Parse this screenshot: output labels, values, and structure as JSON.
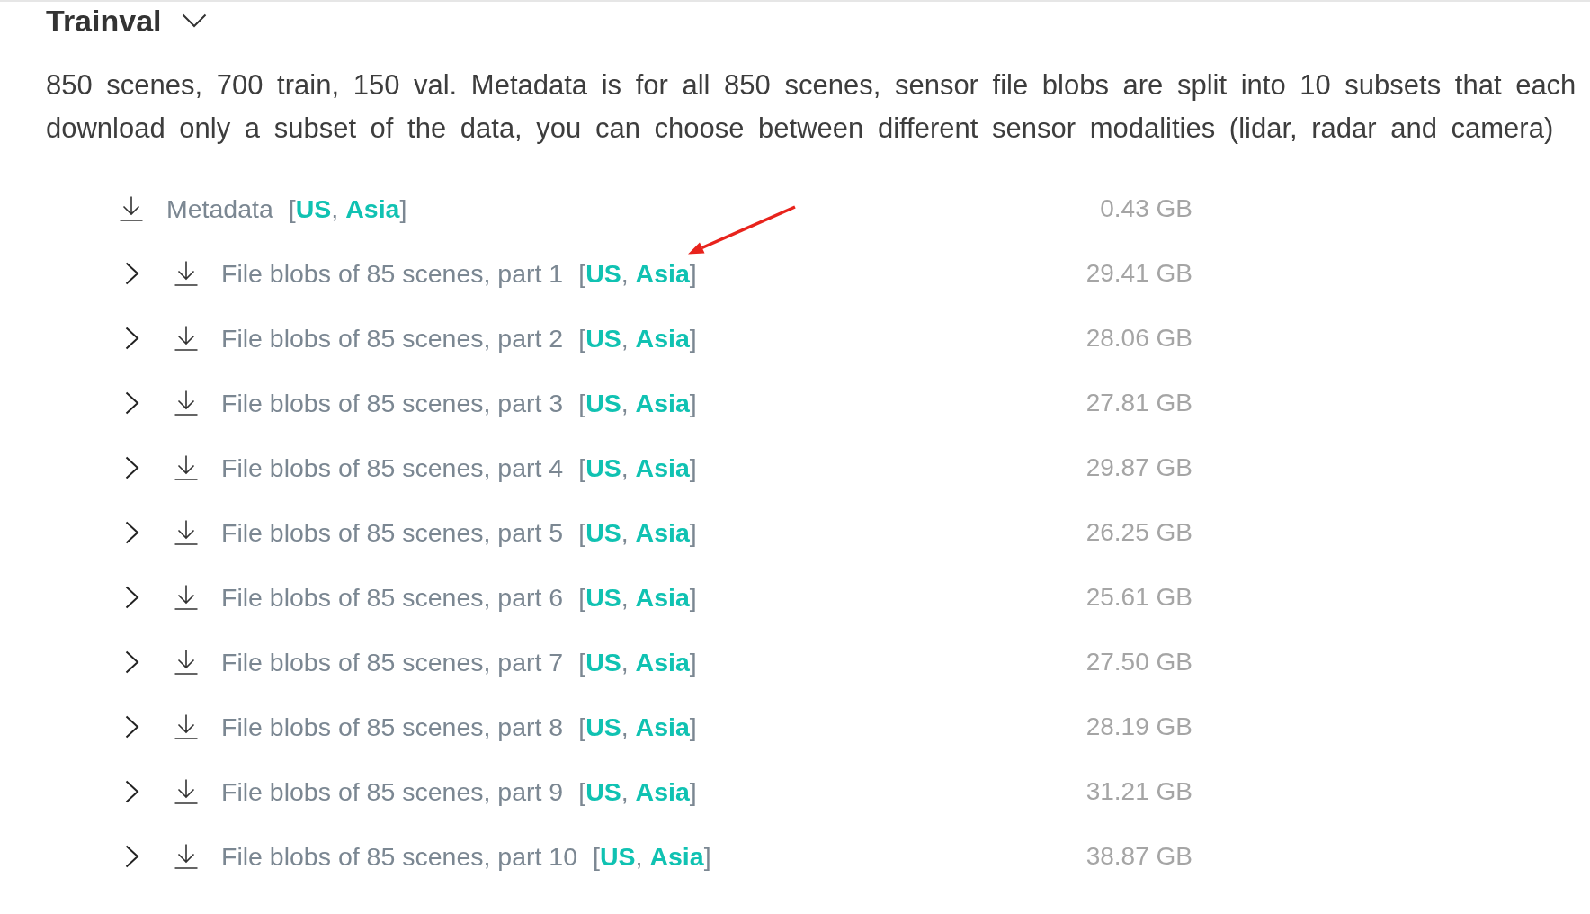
{
  "section": {
    "title": "Trainval",
    "expanded": true,
    "description_lines": [
      "850 scenes, 700 train, 150 val. Metadata is for all 850 scenes, sensor file blobs are split into 10 subsets that each",
      "download only a subset of the data, you can choose between different sensor modalities (lidar, radar and camera)"
    ]
  },
  "rows": [
    {
      "kind": "file",
      "name": "Metadata",
      "regions": "[**US**, **Asia**]",
      "size": "0.43 GB"
    },
    {
      "kind": "group",
      "expanded": false,
      "name": "File blobs of 85 scenes, part 1",
      "regions": "[**US**, **Asia**]",
      "size": "29.41 GB"
    },
    {
      "kind": "group",
      "expanded": false,
      "name": "File blobs of 85 scenes, part 2",
      "regions": "[**US**, **Asia**]",
      "size": "28.06 GB"
    },
    {
      "kind": "group",
      "expanded": false,
      "name": "File blobs of 85 scenes, part 3",
      "regions": "[**US**, **Asia**]",
      "size": "27.81 GB"
    },
    {
      "kind": "group",
      "expanded": false,
      "name": "File blobs of 85 scenes, part 4",
      "regions": "[**US**, **Asia**]",
      "size": "29.87 GB"
    },
    {
      "kind": "group",
      "expanded": false,
      "name": "File blobs of 85 scenes, part 5",
      "regions": "[**US**, **Asia**]",
      "size": "26.25 GB"
    },
    {
      "kind": "group",
      "expanded": false,
      "name": "File blobs of 85 scenes, part 6",
      "regions": "[**US**, **Asia**]",
      "size": "25.61 GB"
    },
    {
      "kind": "group",
      "expanded": false,
      "name": "File blobs of 85 scenes, part 7",
      "regions": "[**US**, **Asia**]",
      "size": "27.50 GB"
    },
    {
      "kind": "group",
      "expanded": false,
      "name": "File blobs of 85 scenes, part 8",
      "regions": "[**US**, **Asia**]",
      "size": "28.19 GB"
    },
    {
      "kind": "group",
      "expanded": false,
      "name": "File blobs of 85 scenes, part 9",
      "regions": "[**US**, **Asia**]",
      "size": "31.21 GB"
    },
    {
      "kind": "group",
      "expanded": false,
      "name": "File blobs of 85 scenes, part 10",
      "regions": "[**US**, **Asia**]",
      "size": "38.87 GB"
    }
  ],
  "annotations": [
    {
      "kind": "arrow"
    }
  ]
}
